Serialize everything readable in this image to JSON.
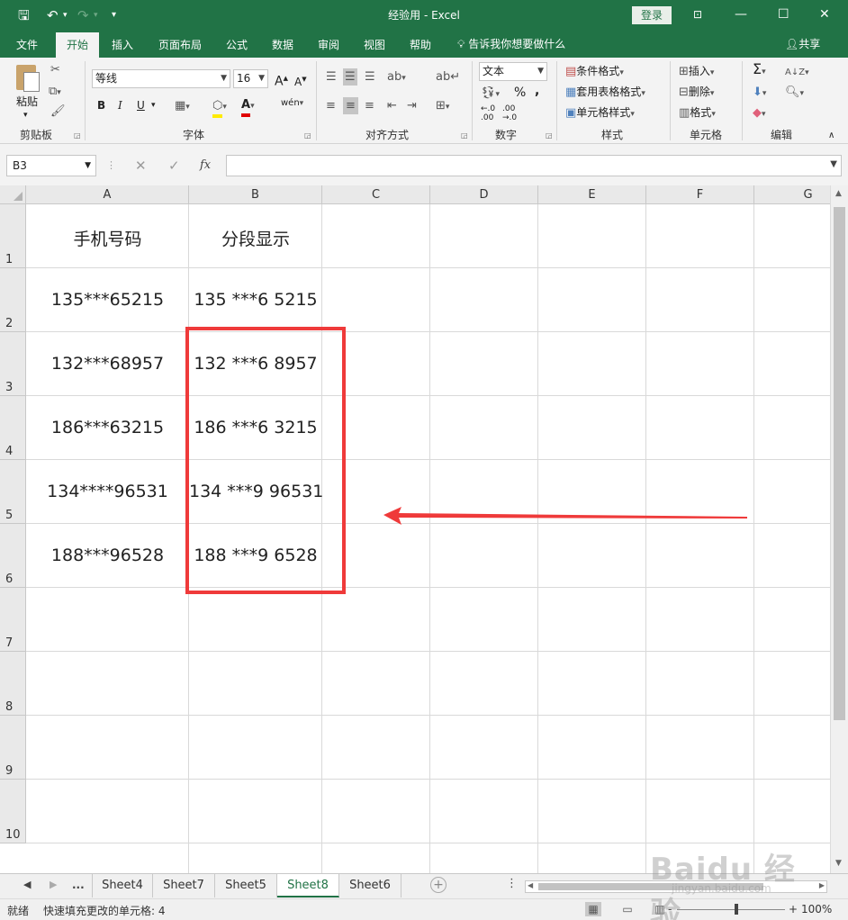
{
  "window": {
    "title": "经验用  -  Excel",
    "login_label": "登录",
    "restore_icon": "ribbon-display-icon",
    "minimize_glyph": "—",
    "maximize_glyph": "☐",
    "close_glyph": "✕"
  },
  "qat": {
    "save_glyph": "🖫",
    "undo_glyph": "↶",
    "redo_glyph": "↷",
    "more_glyph": "▾"
  },
  "tabs": [
    {
      "label": "文件"
    },
    {
      "label": "开始"
    },
    {
      "label": "插入"
    },
    {
      "label": "页面布局"
    },
    {
      "label": "公式"
    },
    {
      "label": "数据"
    },
    {
      "label": "审阅"
    },
    {
      "label": "视图"
    },
    {
      "label": "帮助"
    }
  ],
  "tellme": "告诉我你想要做什么",
  "share": "共享",
  "ribbon": {
    "clipboard": {
      "label": "剪贴板",
      "paste": "粘贴"
    },
    "font": {
      "label": "字体",
      "name": "等线",
      "size": "16",
      "bold": "B",
      "italic": "I",
      "underline": "U",
      "grow": "A",
      "shrink": "A",
      "phonetic": "wén"
    },
    "alignment": {
      "label": "对齐方式"
    },
    "number": {
      "label": "数字",
      "format": "文本",
      "percent": "%",
      "comma": ","
    },
    "styles": {
      "label": "样式",
      "conditional": "条件格式",
      "table": "套用表格格式",
      "cell_styles": "单元格样式"
    },
    "cells": {
      "label": "单元格",
      "insert": "插入",
      "delete": "删除",
      "format": "格式"
    },
    "editing": {
      "label": "编辑"
    }
  },
  "formula_bar": {
    "name_box": "B3",
    "fx": "fx",
    "cancel": "✕",
    "enter": "✓",
    "value": ""
  },
  "grid": {
    "columns": [
      "A",
      "B",
      "C",
      "D",
      "E",
      "F",
      "G"
    ],
    "rows": [
      "1",
      "2",
      "3",
      "4",
      "5",
      "6",
      "7",
      "8",
      "9",
      "10"
    ],
    "cells": [
      [
        "手机号码",
        "分段显示"
      ],
      [
        "135***65215",
        "135 ***6 5215"
      ],
      [
        "132***68957",
        "132 ***6 8957"
      ],
      [
        "186***63215",
        "186 ***6 3215"
      ],
      [
        "134****96531",
        "134 ***9 96531"
      ],
      [
        "188***96528",
        "188 ***9 6528"
      ]
    ]
  },
  "annotation": {
    "box_color": "#ef3a3a",
    "arrow_color": "#ef3a3a"
  },
  "sheets": {
    "ellipsis": "...",
    "tabs": [
      "Sheet4",
      "Sheet7",
      "Sheet5",
      "Sheet8",
      "Sheet6"
    ],
    "active": "Sheet8"
  },
  "status": {
    "ready": "就绪",
    "message": "快速填充更改的单元格: 4",
    "zoom": "100%",
    "zoom_minus": "-",
    "zoom_plus": "+"
  },
  "watermark": {
    "brand": "Baidu 经验",
    "url": "jingyan.baidu.com"
  },
  "colors": {
    "excel_green": "#217346",
    "ribbon_bg": "#f3f3f3",
    "grid_line": "#d9d9d9"
  }
}
